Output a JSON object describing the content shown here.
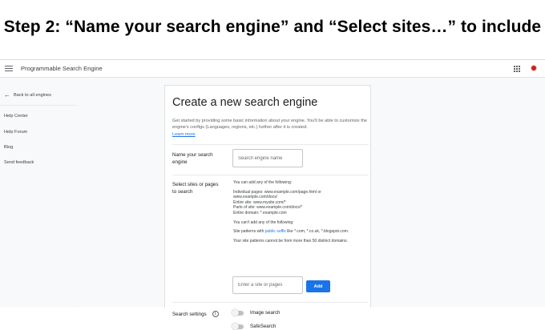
{
  "slide": {
    "title": "Step 2: “Name your search engine” and “Select sites…” to include"
  },
  "topbar": {
    "menu_icon": "hamburger-menu-icon",
    "app_title": "Programmable Search Engine",
    "apps_icon": "apps-grid-icon",
    "avatar_color": "#c5221f"
  },
  "sidebar": {
    "back_label": "Back to all engines",
    "back_icon": "arrow-left-icon",
    "items": [
      {
        "label": "Help Center"
      },
      {
        "label": "Help Forum"
      },
      {
        "label": "Blog"
      },
      {
        "label": "Send feedback"
      }
    ]
  },
  "card": {
    "title": "Create a new search engine",
    "intro": "Get started by providing some basic information about your engine. You'll be able to customize the engine's configs (Languages, regions, etc.) further after it is created.",
    "learn_more": "Learn more",
    "name_field": {
      "label": "Name your search engine",
      "placeholder": "Search engine name",
      "value": ""
    },
    "sites": {
      "label": "Select sites or pages to search",
      "can_add_heading": "You can add any of the following:",
      "can_add_lines": [
        "Individual pages: www.example.com/page.html or",
        "www.example.com/docs/",
        "Entire site: www.mysite.com/*",
        "Parts of site: www.example.com/docs/*",
        "Entire domain: *.example.com"
      ],
      "cannot_add_heading": "You can't add any of the following:",
      "cannot_add_prefix": "Site patterns with",
      "cannot_add_link": "public suffix",
      "cannot_add_suffix": "like *.com, *.co.uk, *.blogspot.com.",
      "limit_note": "Your site patterns cannot be from more than 50 distinct domains.",
      "input_placeholder": "Enter a site or pages",
      "add_button": "Add",
      "accent_color": "#1a73e8"
    },
    "search_settings": {
      "label": "Search settings",
      "info_icon": "info-icon",
      "toggles": [
        {
          "label": "Image search",
          "enabled": false
        },
        {
          "label": "SafeSearch",
          "enabled": false
        }
      ]
    }
  }
}
